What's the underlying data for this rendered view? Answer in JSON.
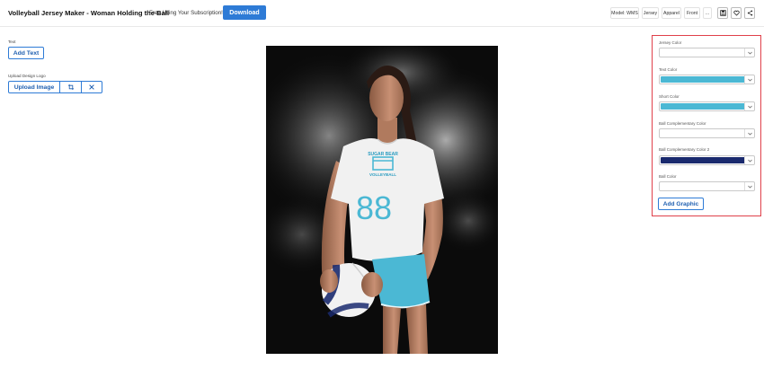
{
  "header": {
    "title": "Volleyball Jersey Maker - Woman Holding the Ball",
    "subscription_text": "Free Using Your Subscription!",
    "download_label": "Download",
    "tags": [
      "Model: WMS",
      "Jersey",
      "Apparel",
      "Front",
      "..."
    ]
  },
  "left": {
    "text_label": "Text",
    "add_text_label": "Add Text",
    "logo_label": "Upload Design Logo",
    "upload_image_label": "Upload Image",
    "crop_icon": "crop-icon",
    "remove_icon": "close-icon"
  },
  "preview": {
    "jersey_text": "SUGAR BEAR",
    "jersey_sub": "VOLLEYBALL",
    "jersey_number": "88"
  },
  "color_panel": {
    "fields": [
      {
        "label": "Jersey Color",
        "color": "#ffffff"
      },
      {
        "label": "Text Color",
        "color": "#4bb8d4"
      },
      {
        "label": "Short Color",
        "color": "#4bb8d4"
      },
      {
        "label": "Ball Complementary Color",
        "color": "#ffffff"
      },
      {
        "label": "Ball Complementary Color 2",
        "color": "#1a2a6e"
      },
      {
        "label": "Ball Color",
        "color": "#ffffff"
      }
    ],
    "add_graphic_label": "Add Graphic"
  },
  "colors": {
    "accent": "#2e7bd6",
    "panel_border": "#e0404a"
  }
}
